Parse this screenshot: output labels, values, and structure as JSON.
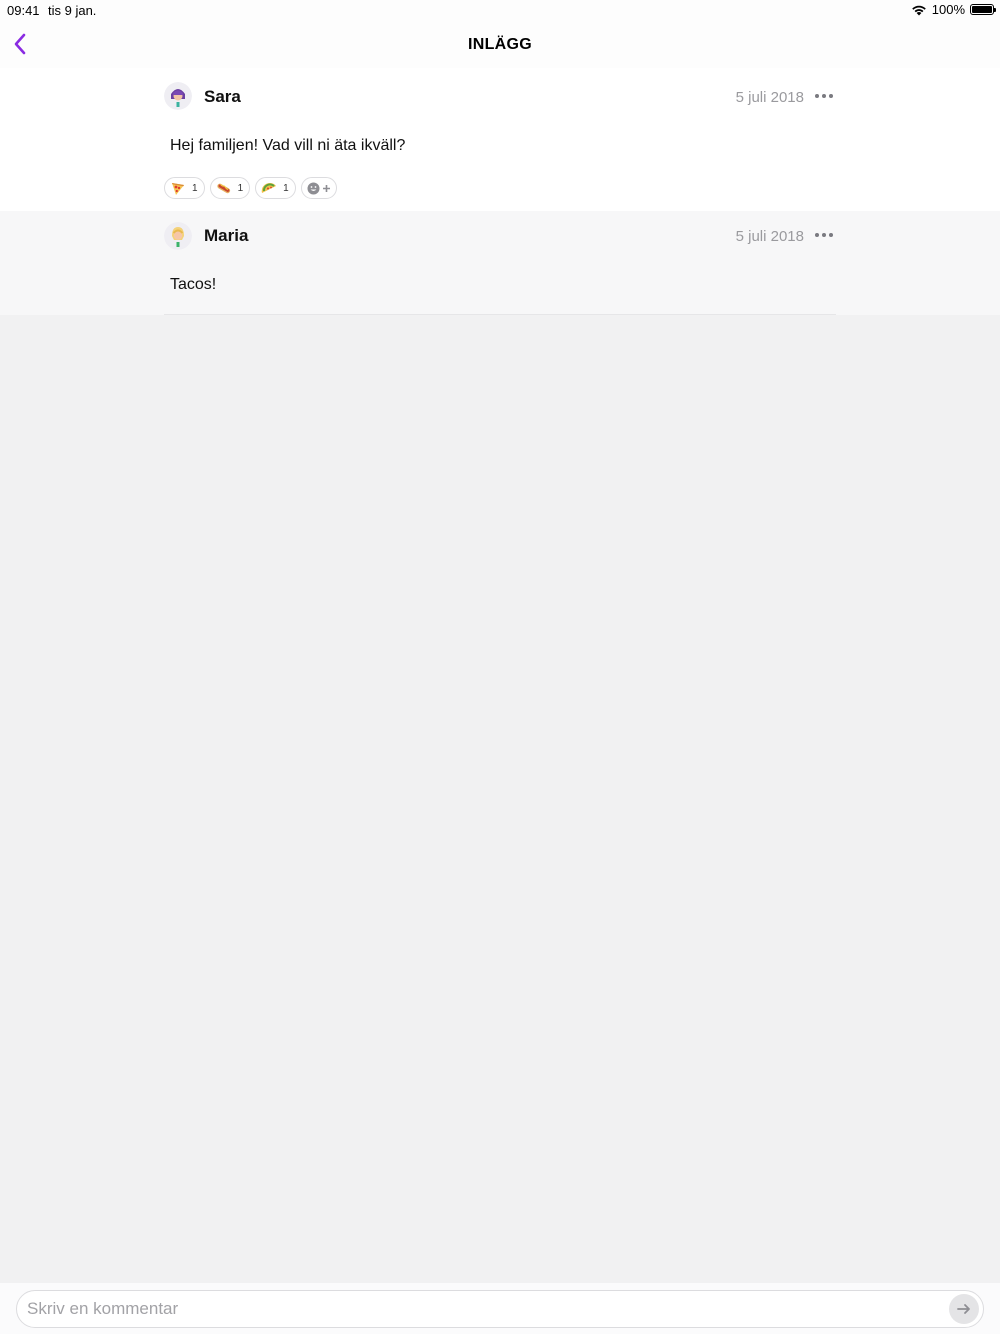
{
  "status_bar": {
    "time": "09:41",
    "date": "tis 9 jan.",
    "battery_text": "100%",
    "wifi_icon": "wifi-icon",
    "battery_icon": "battery-icon"
  },
  "nav": {
    "title": "INLÄGG",
    "back_icon": "chevron-left-icon",
    "accent_color": "#8a2be2"
  },
  "posts": [
    {
      "author": "Sara",
      "date": "5 juli 2018",
      "text": "Hej familjen!  Vad vill ni äta ikväll?",
      "avatar_icon": "avatar-sara",
      "reactions": [
        {
          "emoji": "pizza-emoji",
          "count": "1"
        },
        {
          "emoji": "hotdog-emoji",
          "count": "1"
        },
        {
          "emoji": "taco-emoji",
          "count": "1"
        }
      ],
      "add_reaction_icon": "add-reaction-icon"
    },
    {
      "author": "Maria",
      "date": "5 juli 2018",
      "text": "Tacos!",
      "avatar_icon": "avatar-maria"
    }
  ],
  "composer": {
    "placeholder": "Skriv en kommentar",
    "value": "",
    "send_icon": "arrow-right-icon"
  }
}
